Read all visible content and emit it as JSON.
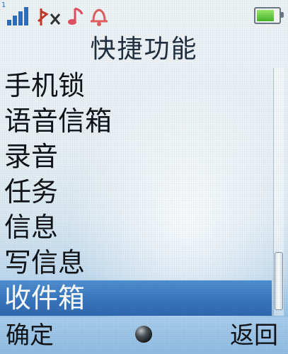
{
  "title": "快捷功能",
  "menu": {
    "items": [
      {
        "label": "手机锁"
      },
      {
        "label": "语音信箱"
      },
      {
        "label": "录音"
      },
      {
        "label": "任务"
      },
      {
        "label": "信息"
      },
      {
        "label": "写信息"
      },
      {
        "label": "收件箱"
      }
    ],
    "selected_index": 6
  },
  "softkeys": {
    "left": "确定",
    "right": "返回"
  },
  "status_bar": {
    "signal_icon": "signal-bars-icon",
    "signal_digit": "1",
    "icons": [
      "bluetooth-off-icon",
      "music-note-icon",
      "ringer-bell-icon"
    ],
    "battery_icon": "battery-icon"
  },
  "colors": {
    "selection": "#3a78c0",
    "text": "#101418",
    "accent": "#2a6fc2"
  }
}
